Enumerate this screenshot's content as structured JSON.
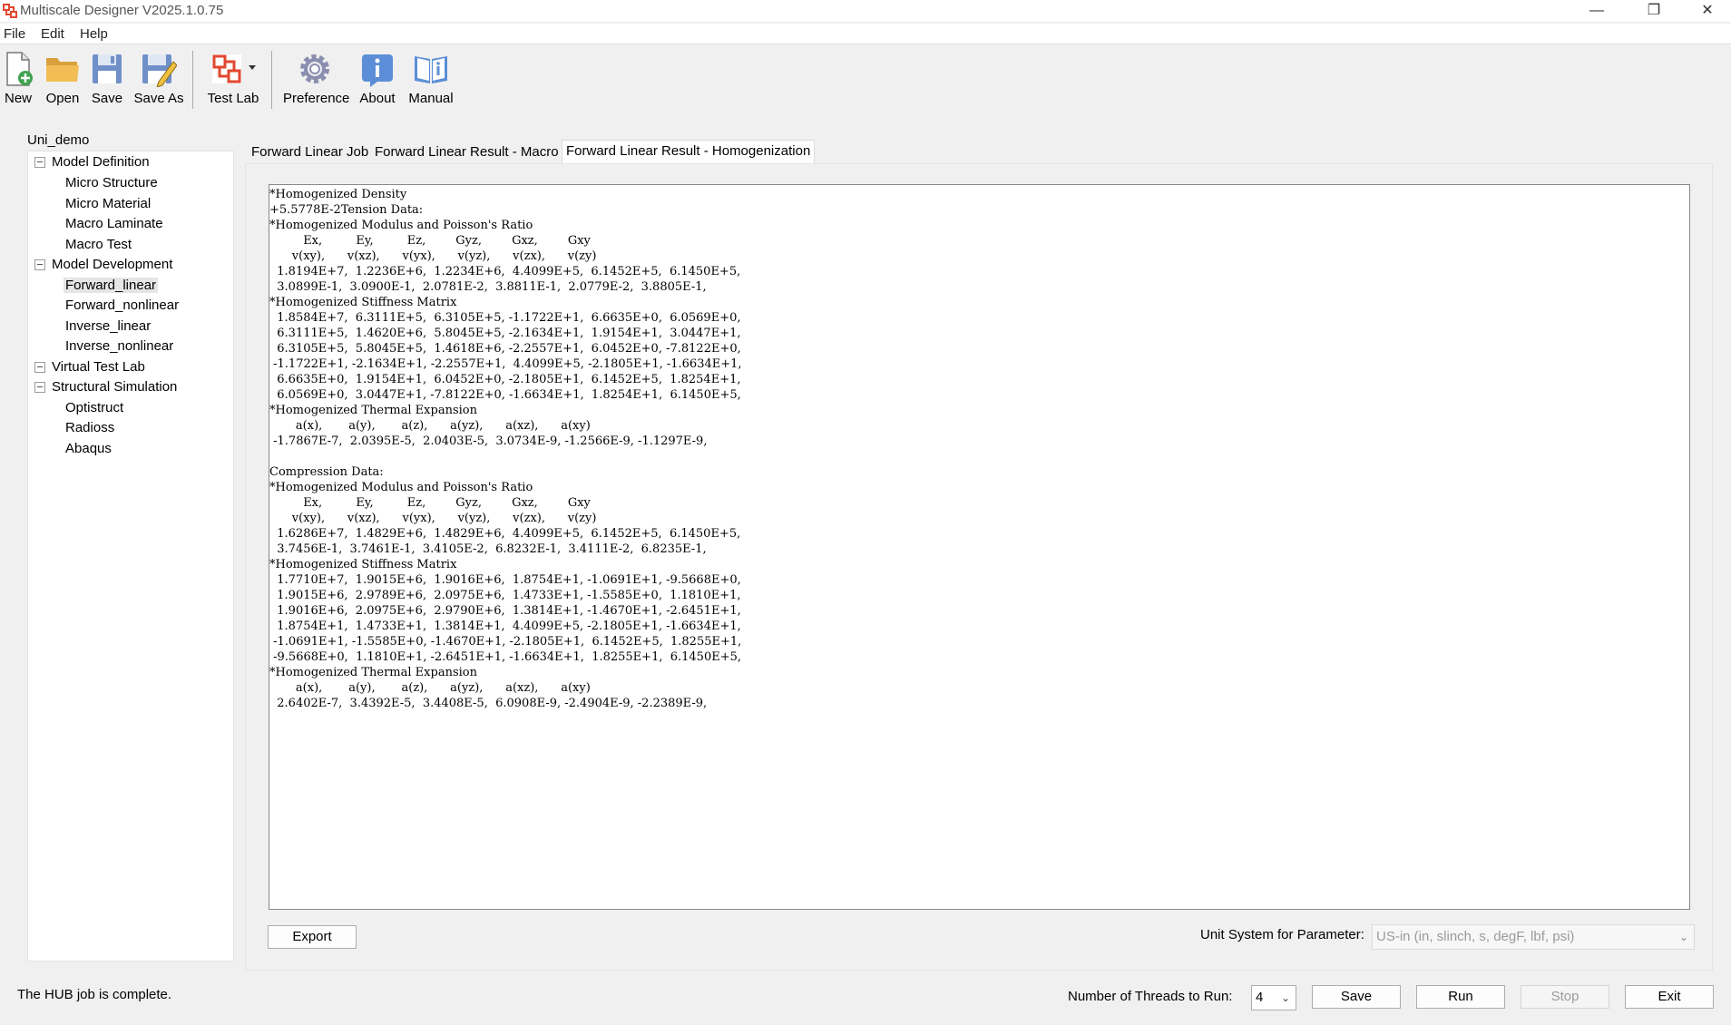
{
  "window": {
    "title": "Multiscale Designer V2025.1.0.75",
    "minimize": "—",
    "restore": "❐",
    "close": "✕"
  },
  "menu": [
    "File",
    "Edit",
    "Help"
  ],
  "toolbar": {
    "new": "New",
    "open": "Open",
    "save": "Save",
    "save_as": "Save As",
    "test_lab": "Test Lab",
    "preference": "Preference",
    "about": "About",
    "manual": "Manual"
  },
  "tree": {
    "root": "Uni_demo",
    "groups": [
      {
        "label": "Model Definition",
        "items": [
          "Micro Structure",
          "Micro Material",
          "Macro Laminate",
          "Macro Test"
        ]
      },
      {
        "label": "Model Development",
        "items": [
          "Forward_linear",
          "Forward_nonlinear",
          "Inverse_linear",
          "Inverse_nonlinear"
        ]
      },
      {
        "label": "Virtual Test Lab",
        "items": []
      },
      {
        "label": "Structural Simulation",
        "items": [
          "Optistruct",
          "Radioss",
          "Abaqus"
        ]
      }
    ],
    "selected": "Forward_linear"
  },
  "tabs": [
    "Forward Linear Job",
    "Forward Linear Result - Macro",
    "Forward Linear Result - Homogenization"
  ],
  "active_tab": 2,
  "result_text": "*Homogenized Density\n+5.5778E-2Tension Data:\n*Homogenized Modulus and Poisson's Ratio\n         Ex,         Ey,         Ez,        Gyz,        Gxz,        Gxy\n      v(xy),      v(xz),      v(yx),      v(yz),      v(zx),      v(zy)\n  1.8194E+7,  1.2236E+6,  1.2234E+6,  4.4099E+5,  6.1452E+5,  6.1450E+5,\n  3.0899E-1,  3.0900E-1,  2.0781E-2,  3.8811E-1,  2.0779E-2,  3.8805E-1,\n*Homogenized Stiffness Matrix\n  1.8584E+7,  6.3111E+5,  6.3105E+5, -1.1722E+1,  6.6635E+0,  6.0569E+0,\n  6.3111E+5,  1.4620E+6,  5.8045E+5, -2.1634E+1,  1.9154E+1,  3.0447E+1,\n  6.3105E+5,  5.8045E+5,  1.4618E+6, -2.2557E+1,  6.0452E+0, -7.8122E+0,\n -1.1722E+1, -2.1634E+1, -2.2557E+1,  4.4099E+5, -2.1805E+1, -1.6634E+1,\n  6.6635E+0,  1.9154E+1,  6.0452E+0, -2.1805E+1,  6.1452E+5,  1.8254E+1,\n  6.0569E+0,  3.0447E+1, -7.8122E+0, -1.6634E+1,  1.8254E+1,  6.1450E+5,\n*Homogenized Thermal Expansion\n       a(x),       a(y),       a(z),      a(yz),      a(xz),      a(xy)\n -1.7867E-7,  2.0395E-5,  2.0403E-5,  3.0734E-9, -1.2566E-9, -1.1297E-9,\n\nCompression Data:\n*Homogenized Modulus and Poisson's Ratio\n         Ex,         Ey,         Ez,        Gyz,        Gxz,        Gxy\n      v(xy),      v(xz),      v(yx),      v(yz),      v(zx),      v(zy)\n  1.6286E+7,  1.4829E+6,  1.4829E+6,  4.4099E+5,  6.1452E+5,  6.1450E+5,\n  3.7456E-1,  3.7461E-1,  3.4105E-2,  6.8232E-1,  3.4111E-2,  6.8235E-1,\n*Homogenized Stiffness Matrix\n  1.7710E+7,  1.9015E+6,  1.9016E+6,  1.8754E+1, -1.0691E+1, -9.5668E+0,\n  1.9015E+6,  2.9789E+6,  2.0975E+6,  1.4733E+1, -1.5585E+0,  1.1810E+1,\n  1.9016E+6,  2.0975E+6,  2.9790E+6,  1.3814E+1, -1.4670E+1, -2.6451E+1,\n  1.8754E+1,  1.4733E+1,  1.3814E+1,  4.4099E+5, -2.1805E+1, -1.6634E+1,\n -1.0691E+1, -1.5585E+0, -1.4670E+1, -2.1805E+1,  6.1452E+5,  1.8255E+1,\n -9.5668E+0,  1.1810E+1, -2.6451E+1, -1.6634E+1,  1.8255E+1,  6.1450E+5,\n*Homogenized Thermal Expansion\n       a(x),       a(y),       a(z),      a(yz),      a(xz),      a(xy)\n  2.6402E-7,  3.4392E-5,  3.4408E-5,  6.0908E-9, -2.4904E-9, -2.2389E-9,",
  "export_label": "Export",
  "unit_system": {
    "label": "Unit System for Parameter:",
    "value": "US-in (in, slinch, s, degF, lbf, psi)"
  },
  "status_text": "The HUB job is complete.",
  "threads": {
    "label": "Number of Threads to Run:",
    "value": "4"
  },
  "bottom_buttons": {
    "save": "Save",
    "run": "Run",
    "stop": "Stop",
    "exit": "Exit"
  }
}
